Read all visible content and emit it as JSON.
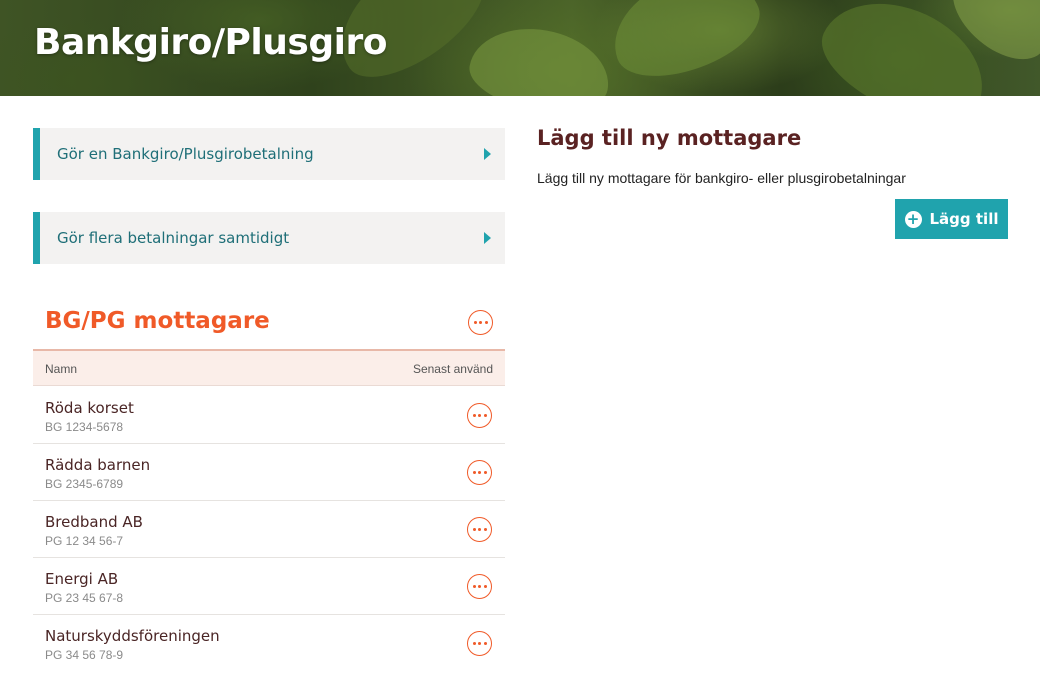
{
  "header": {
    "title": "Bankgiro/Plusgiro"
  },
  "quick_links": [
    {
      "label": "Gör en Bankgiro/Plusgirobetalning"
    },
    {
      "label": "Gör flera betalningar samtidigt"
    }
  ],
  "recipients": {
    "title": "BG/PG mottagare",
    "columns": {
      "name": "Namn",
      "last_used": "Senast använd"
    },
    "rows": [
      {
        "name": "Röda korset",
        "number": "BG 1234-5678"
      },
      {
        "name": "Rädda barnen",
        "number": "BG 2345-6789"
      },
      {
        "name": "Bredband AB",
        "number": "PG 12 34 56-7"
      },
      {
        "name": "Energi AB",
        "number": "PG 23 45 67-8"
      },
      {
        "name": "Naturskyddsföreningen",
        "number": "PG 34 56 78-9"
      }
    ]
  },
  "add_recipient": {
    "title": "Lägg till ny mottagare",
    "description": "Lägg till ny mottagare för bankgiro- eller plusgirobetalningar",
    "button_label": "Lägg till"
  },
  "colors": {
    "accent": "#20a3ad",
    "orange": "#f05a28",
    "heading": "#5a2222"
  }
}
